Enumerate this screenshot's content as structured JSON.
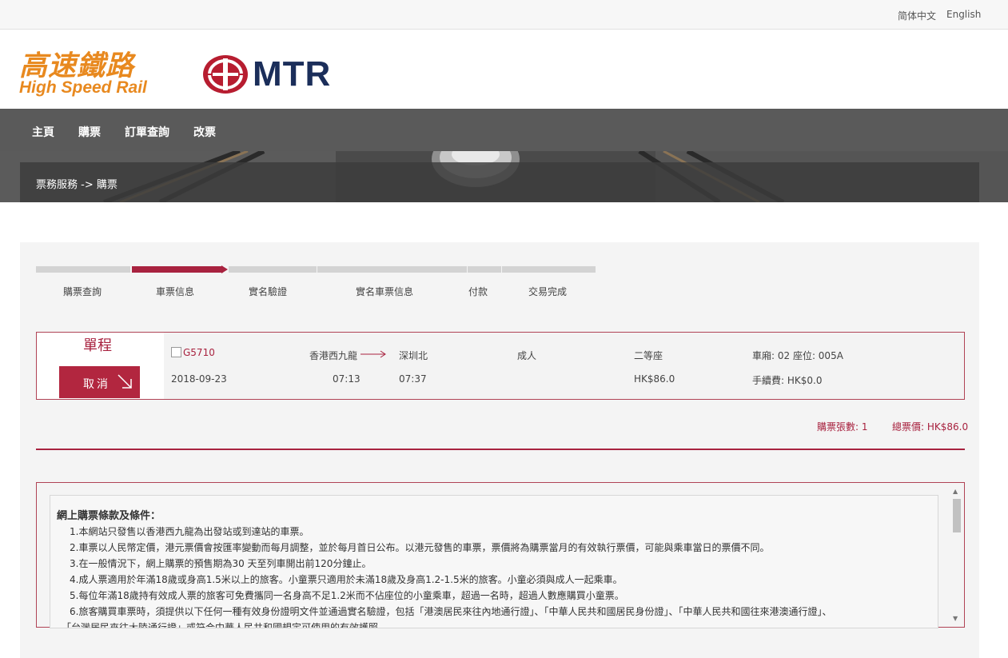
{
  "lang": {
    "simplified": "简体中文",
    "english": "English"
  },
  "logo": {
    "hsr_cn": "高速鐵路",
    "hsr_en": "High Speed Rail",
    "mtr": "MTR"
  },
  "nav": {
    "home": "主頁",
    "buy": "購票",
    "order_query": "訂單查詢",
    "change": "改票"
  },
  "breadcrumb": "票務服務 -> 購票",
  "steps": [
    "購票查詢",
    "車票信息",
    "實名驗證",
    "實名車票信息",
    "付款",
    "交易完成"
  ],
  "order": {
    "type": "單程",
    "cancel_label": "取消",
    "train_no": "G5710",
    "date": "2018-09-23",
    "from": "香港西九龍",
    "to": "深圳北",
    "depart_time": "07:13",
    "arrive_time": "07:37",
    "passenger": "成人",
    "seat_class": "二等座",
    "car_seat": "車廂: 02   座位: 005A",
    "price": "HK$86.0",
    "fee": "手續費: HK$0.0"
  },
  "summary": {
    "count": "購票張數: 1",
    "total": "總票價: HK$86.0"
  },
  "terms": {
    "title": "網上購票條款及條件：",
    "items": [
      "1.本網站只發售以香港西九龍為出發站或到達站的車票。",
      "2.車票以人民幣定價，港元票價會按匯率變動而每月調整，並於每月首日公布。以港元發售的車票，票價將為購票當月的有效執行票價，可能與乘車當日的票價不同。",
      "3.在一般情況下，網上購票的預售期為30 天至列車開出前120分鐘止。",
      "4.成人票適用於年滿18歲或身高1.5米以上的旅客。小童票只適用於未滿18歲及身高1.2-1.5米的旅客。小童必須與成人一起乘車。",
      "5.每位年滿18歲持有效成人票的旅客可免費攜同一名身高不足1.2米而不佔座位的小童乘車，超過一名時，超過人數應購買小童票。",
      "6.旅客購買車票時，須提供以下任何一種有效身份證明文件並通過實名驗證，包括「港澳居民來往內地通行證」、「中華人民共和國居民身份證」、「中華人民共和國往來港澳通行證」、",
      "「台灣居民來往大陸通行證」或符合中華人民共和國規定可使用的有效護照。"
    ]
  },
  "colors": {
    "accent": "#a8223f",
    "nav_bg": "#5a5a5a",
    "hsr_orange": "#e8891f",
    "mtr_navy": "#1b2e5a"
  }
}
